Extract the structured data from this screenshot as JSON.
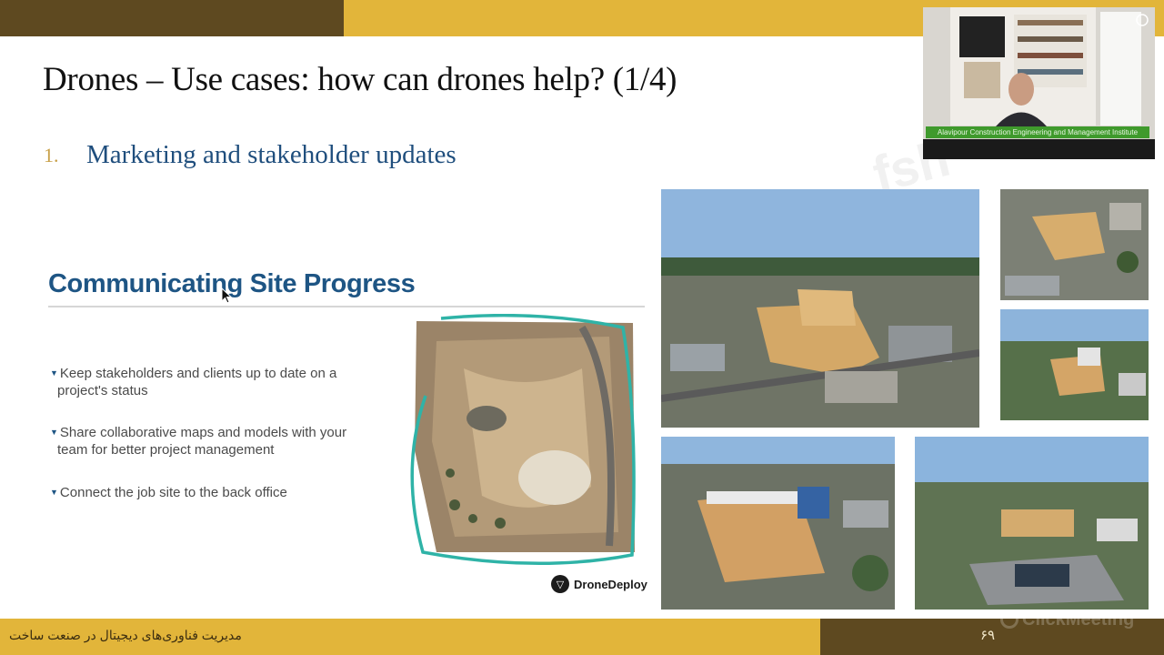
{
  "slide": {
    "title": "Drones – Use cases: how can drones help? (1/4)",
    "item_number": "1.",
    "item_text": "Marketing and stakeholder updates"
  },
  "embedded_slide": {
    "title": "Communicating Site Progress",
    "bullets": [
      {
        "line1": "Keep stakeholders and clients up to date on a",
        "line2": "project's status"
      },
      {
        "line1": "Share collaborative maps and models with your",
        "line2": "team for better project management"
      },
      {
        "line1": "Connect the job site to the back office",
        "line2": ""
      }
    ],
    "logo_text": "DroneDeploy"
  },
  "footer": {
    "text": "مدیریت فناوری‌های دیجیتال در صنعت ساخت",
    "page_number": "۶۹",
    "brand_watermark": "ClickMeeting"
  },
  "webcam": {
    "caption": "Alavipour Construction Engineering and Management Institute"
  },
  "colors": {
    "accent_gold": "#e2b53a",
    "accent_dark": "#5e4920",
    "title_blue": "#1f4e7d",
    "annotation_teal": "#2fb3a7"
  }
}
